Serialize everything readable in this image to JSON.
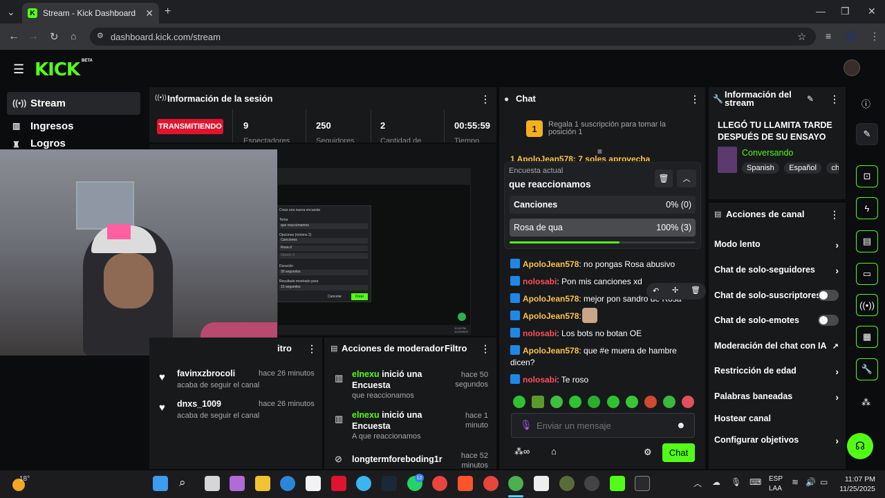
{
  "browser": {
    "tab_title": "Stream - Kick Dashboard",
    "tab_favicon_letter": "K",
    "url": "dashboard.kick.com/stream",
    "new_tab_symbol": "+"
  },
  "header": {
    "logo": "KICK",
    "beta": "BETA"
  },
  "sidebar": {
    "items": [
      {
        "label": "Stream",
        "icon": "broadcast-icon"
      },
      {
        "label": "Ingresos",
        "icon": "chart-icon"
      },
      {
        "label": "Logros",
        "icon": "trophy-icon"
      }
    ]
  },
  "session": {
    "title": "Información de la sesión",
    "status": "TRANSMITIENDO",
    "stats": [
      {
        "value": "9",
        "label": "Espectadores"
      },
      {
        "value": "250",
        "label": "Seguidores"
      },
      {
        "value": "2",
        "label": "Cantidad de"
      },
      {
        "value": "00:55:59",
        "label": "Tiempo"
      }
    ]
  },
  "overlay_dialog": {
    "title": "Crear una nueva encuesta",
    "tema_label": "Tema",
    "tema_value": "que reaccionamos",
    "opciones_label": "Opciones (mínimo 2)",
    "options": [
      "Canciones",
      "Rosa d",
      "Opción 3"
    ],
    "duracion_label": "Duración",
    "duracion_value": "30 segundos",
    "resultado_label": "Resultado mostrado para",
    "resultado_value": "15 segundos",
    "cancel": "Cancelar",
    "create": "Crear",
    "clock_time": "11:06 PM",
    "clock_date": "11/25/2025"
  },
  "activity": {
    "title_partial": "itro",
    "items": [
      {
        "user": "favinxzbrocoli",
        "action": "acaba de seguir el canal",
        "time": "hace 26 minutos"
      },
      {
        "user": "dnxs_1009",
        "action": "acaba de seguir el canal",
        "time": "hace 26 minutos"
      }
    ]
  },
  "modactions": {
    "title": "Acciones de moderador",
    "filter": "Filtro",
    "items": [
      {
        "user": "elnexu",
        "action": "inició una Encuesta",
        "detail": "que reaccionamos",
        "time": "hace 50 segundos"
      },
      {
        "user": "elnexu",
        "action": "inició una Encuesta",
        "detail": "A que reaccionamos",
        "time": "hace 1 minuto"
      },
      {
        "user": "longtermforeboding1r",
        "action": "",
        "detail": "",
        "time": "hace 52 minutos"
      }
    ]
  },
  "chat": {
    "title": "Chat",
    "gift_rank": "1",
    "gift_text": "Regala 1 suscripción para tomar el primer lugar",
    "gift_line1": "Regala 1 suscripción para tomar la",
    "gift_line2": "posición 1",
    "pinned_preview": "1 ApoloJean578: 7 soles aprovecha",
    "poll": {
      "label": "Encuesta actual",
      "question": "que reaccionamos",
      "options": [
        {
          "name": "Canciones",
          "result": "0% (0)",
          "pct": 0
        },
        {
          "name": "Rosa de qua",
          "result": "100% (3)",
          "pct": 100
        }
      ],
      "time_remaining_fraction": 0.59
    },
    "messages": [
      {
        "user": "ApoloJean578",
        "color": "gold",
        "text": "no pongas Rosa abusivo"
      },
      {
        "user": "nolosabi",
        "color": "red",
        "text": "Pon mis canciones xd"
      },
      {
        "user": "ApoloJean578",
        "color": "gold",
        "text": "mejor pon sandro de Rosa rosa"
      },
      {
        "user": "ApoloJean578",
        "color": "gold",
        "text": ""
      },
      {
        "user": "nolosabi",
        "color": "red",
        "text": "Los bots no botan OE"
      },
      {
        "user": "ApoloJean578",
        "color": "gold",
        "text": "que #e muera de hambre dicen?"
      },
      {
        "user": "nolosabi",
        "color": "red",
        "text": "Te roso"
      }
    ],
    "input_placeholder": "Enviar un mensaje",
    "send": "Chat"
  },
  "stream_info": {
    "title": "Información del stream",
    "stream_title": "LLEGÓ TU LLAMITA TARDE DESPUÉS DE SU ENSAYO —...",
    "category": "Conversando",
    "tags": [
      "Spanish",
      "Español",
      "chi"
    ]
  },
  "channel_actions": {
    "title": "Acciones de canal",
    "items": [
      {
        "label": "Modo lento",
        "control": "chevron"
      },
      {
        "label": "Chat de solo-seguidores",
        "control": "chevron"
      },
      {
        "label": "Chat de solo-suscriptores",
        "control": "toggle",
        "on": false
      },
      {
        "label": "Chat de solo-emotes",
        "control": "toggle",
        "on": false
      },
      {
        "label": "Moderación del chat con IA",
        "control": "external"
      },
      {
        "label": "Restricción de edad",
        "control": "chevron"
      },
      {
        "label": "Palabras baneadas",
        "control": "chevron"
      },
      {
        "label": "Hostear canal",
        "control": "none"
      },
      {
        "label": "Configurar objetivos",
        "control": "chevron"
      }
    ]
  },
  "taskbar": {
    "weather": "18°",
    "lang1": "ESP",
    "lang2": "LAA",
    "time": "11:07 PM",
    "date": "11/25/2025",
    "whatsapp_badge": "12"
  },
  "colors": {
    "accent": "#53fc18",
    "live_red": "#e0142e",
    "panel": "#18191b",
    "bg": "#0b0c0d"
  }
}
